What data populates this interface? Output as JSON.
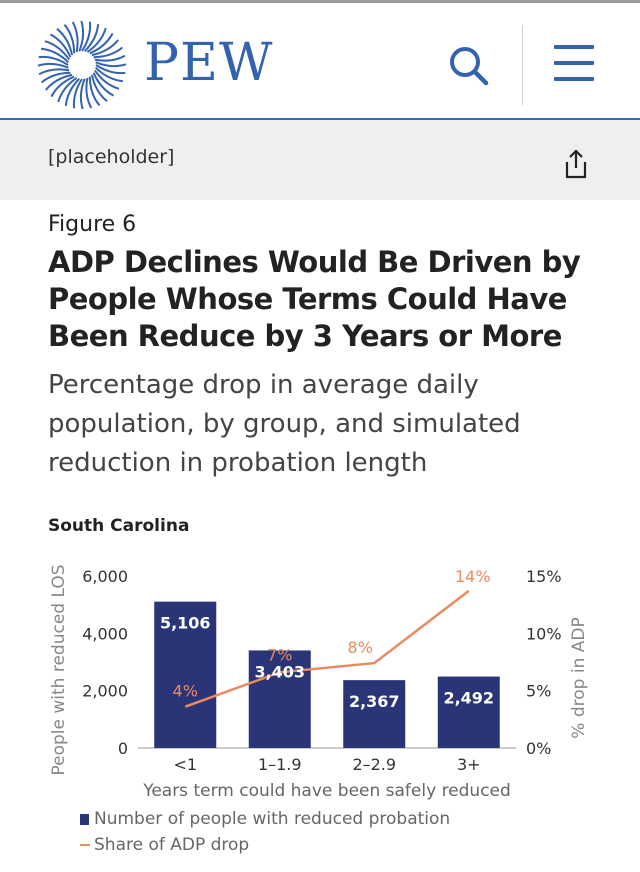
{
  "header": {
    "brand": "PEW",
    "search_icon": "search-icon",
    "menu_icon": "hamburger-menu-icon",
    "brand_color": "#3463ad"
  },
  "toolbar": {
    "title": "[placeholder]",
    "share_icon": "share-icon"
  },
  "figure": {
    "label": "Figure 6",
    "title": "ADP Declines Would Be Driven by People Whose Terms Could Have Been Reduce by 3 Years or More",
    "subtitle": "Percentage drop in average daily population, by group, and simulated reduction in probation length",
    "region": "South Carolina"
  },
  "chart_data": {
    "type": "bar",
    "categories": [
      "<1",
      "1–1.9",
      "2–2.9",
      "3+"
    ],
    "series": [
      {
        "name": "Number of people with reduced probation",
        "type": "bar",
        "axis": "left",
        "values": [
          5106,
          3403,
          2367,
          2492
        ],
        "labels": [
          "5,106",
          "3,403",
          "2,367",
          "2,492"
        ],
        "color": "#2a3577"
      },
      {
        "name": "Share of ADP drop",
        "type": "line",
        "axis": "right",
        "values": [
          3.6,
          6.6,
          7.4,
          13.7
        ],
        "labels": [
          "4%",
          "7%",
          "8%",
          "14%"
        ],
        "color": "#e98a5f"
      }
    ],
    "xlabel": "Years term could have been safely reduced",
    "ylabel": "People with reduced LOS",
    "y2label": "% drop in ADP",
    "ylim": [
      0,
      6000
    ],
    "y2lim": [
      0,
      15
    ],
    "yticks": [
      "0",
      "2,000",
      "4,000",
      "6,000"
    ],
    "y2ticks": [
      "0%",
      "5%",
      "10%",
      "15%"
    ],
    "legend_position": "bottom-left",
    "grid": false
  }
}
